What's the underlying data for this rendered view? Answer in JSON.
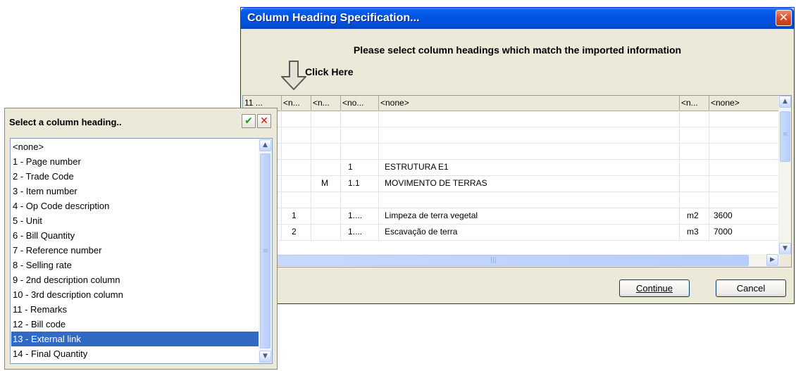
{
  "dialog": {
    "title": "Column Heading Specification...",
    "close_glyph": "✕",
    "instruction": "Please select column headings which match the imported information",
    "click_here": "Click Here",
    "arrow_icon": "down-arrow-icon",
    "continue_label": "Continue",
    "cancel_label": "Cancel"
  },
  "grid": {
    "headers": [
      "11 ...",
      "<n...",
      "<n...",
      "<no...",
      "<none>",
      "<n...",
      "<none>"
    ],
    "rows": [
      [
        "",
        "",
        "",
        "",
        "",
        "",
        ""
      ],
      [
        "",
        "",
        "",
        "",
        "",
        "",
        ""
      ],
      [
        "",
        "",
        "",
        "",
        "",
        "",
        ""
      ],
      [
        "",
        "",
        "",
        "1",
        "ESTRUTURA E1",
        "",
        ""
      ],
      [
        "",
        "",
        "M",
        "1.1",
        "MOVIMENTO DE TERRAS",
        "",
        ""
      ],
      [
        "",
        "",
        "",
        "",
        "",
        "",
        ""
      ],
      [
        "",
        "1",
        "",
        "1....",
        "Limpeza de terra vegetal",
        "m2",
        "3600"
      ],
      [
        "",
        "2",
        "",
        "1....",
        "Escavação de terra",
        "m3",
        "7000"
      ]
    ],
    "scroll_icons": {
      "up": "▲",
      "down": "▼",
      "right": "▶"
    }
  },
  "popup": {
    "title": "Select a column heading..",
    "ok_icon": "✔",
    "cancel_icon": "✕",
    "items": [
      "<none>",
      "1 - Page number",
      "2 - Trade Code",
      "3 - Item number",
      "4 - Op Code description",
      "5 - Unit",
      "6 - Bill Quantity",
      "7 - Reference number",
      "8 - Selling rate",
      "9 - 2nd description column",
      "10 - 3rd description column",
      "11 - Remarks",
      "12 - Bill code",
      "13 - External link",
      "14 - Final Quantity"
    ],
    "selected_index": 13
  },
  "colors": {
    "title_bar": "#0054e3",
    "selection": "#316ac5",
    "dialog_bg": "#ece9d8"
  }
}
